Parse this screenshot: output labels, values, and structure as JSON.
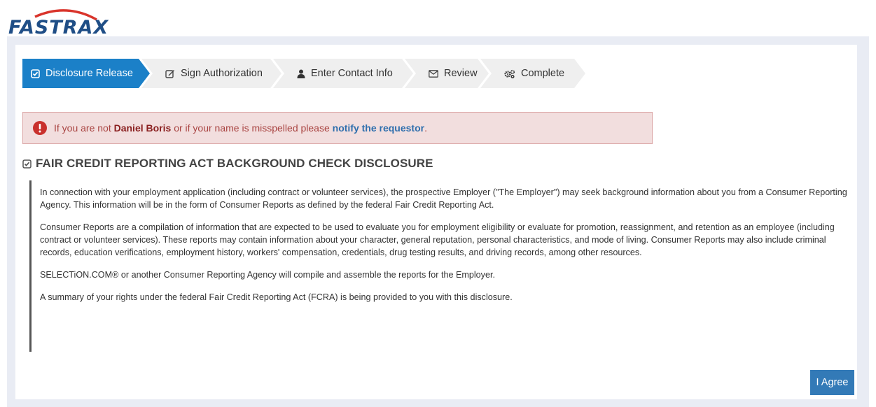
{
  "brand": {
    "name": "FASTRAX",
    "color": "#1f4e86",
    "accent": "#d9342b"
  },
  "steps": [
    {
      "label": "Disclosure Release",
      "icon": "check-square-icon",
      "active": true
    },
    {
      "label": "Sign Authorization",
      "icon": "edit-icon",
      "active": false
    },
    {
      "label": "Enter Contact Info",
      "icon": "user-icon",
      "active": false
    },
    {
      "label": "Review",
      "icon": "envelope-icon",
      "active": false
    },
    {
      "label": "Complete",
      "icon": "cogs-icon",
      "active": false
    }
  ],
  "alert": {
    "icon": "exclamation-circle-icon",
    "prefix": "If you are not ",
    "name": "Daniel Boris",
    "middle": " or if your name is misspelled please ",
    "link": "notify the requestor",
    "suffix": "."
  },
  "heading": "FAIR CREDIT REPORTING ACT BACKGROUND CHECK DISCLOSURE",
  "paragraphs": [
    "In connection with your employment application (including contract or volunteer services), the prospective Employer (\"The Employer\") may seek background information about you from a Consumer Reporting Agency. This information will be in the form of Consumer Reports as defined by the federal Fair Credit Reporting Act.",
    "Consumer Reports are a compilation of information that are expected to be used to evaluate you for employment eligibility or evaluate for promotion, reassignment, and retention as an employee (including contract or volunteer services). These reports may contain information about your character, general reputation, personal characteristics, and mode of living. Consumer Reports may also include criminal records, education verifications, employment history, workers' compensation, credentials, drug testing results, and driving records, among other resources.",
    "SELECTiON.COM® or another Consumer Reporting Agency will compile and assemble the reports for the Employer.",
    "A summary of your rights under the federal Fair Credit Reporting Act (FCRA) is being provided to you with this disclosure."
  ],
  "agree_label": "I Agree"
}
